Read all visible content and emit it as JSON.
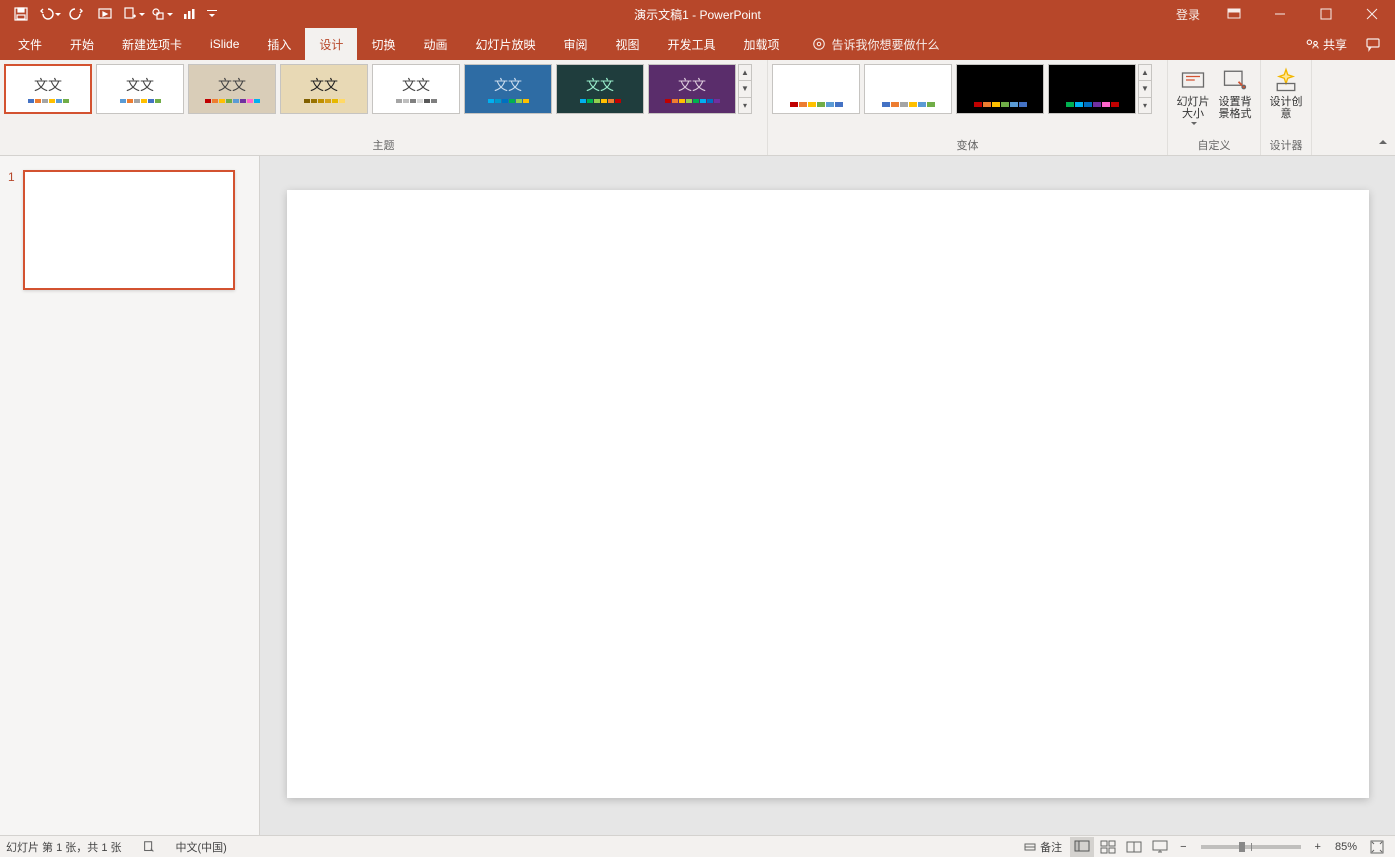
{
  "title": "演示文稿1  -  PowerPoint",
  "login": "登录",
  "tabs": [
    "文件",
    "开始",
    "新建选项卡",
    "iSlide",
    "插入",
    "设计",
    "切换",
    "动画",
    "幻灯片放映",
    "审阅",
    "视图",
    "开发工具",
    "加载项"
  ],
  "active_tab": "设计",
  "tell_me": "告诉我你想要做什么",
  "share": "共享",
  "groups": {
    "themes": "主题",
    "variants": "变体",
    "customize": "自定义",
    "designer": "设计器"
  },
  "customize": {
    "slide_size": "幻灯片大小",
    "background": "设置背景格式",
    "design_ideas": "设计创意"
  },
  "theme_sample": "文文",
  "theme_palettes": [
    [
      "#4472c4",
      "#ed7d31",
      "#a5a5a5",
      "#ffc000",
      "#5b9bd5",
      "#70ad47"
    ],
    [
      "#5b9bd5",
      "#ed7d31",
      "#a5a5a5",
      "#ffc000",
      "#4472c4",
      "#70ad47"
    ],
    [
      "#c00000",
      "#ed7d31",
      "#ffc000",
      "#70ad47",
      "#5b9bd5",
      "#7030a0",
      "#ff66cc",
      "#00b0f0"
    ],
    [
      "#806000",
      "#997300",
      "#bf8f00",
      "#d4a017",
      "#e6b800",
      "#ffd966"
    ],
    [
      "#a5a5a5",
      "#bfbfbf",
      "#808080",
      "#d9d9d9",
      "#595959",
      "#7f7f7f"
    ],
    [
      "#00b0f0",
      "#0099cc",
      "#0070c0",
      "#00b050",
      "#92d050",
      "#ffc000"
    ],
    [
      "#00b0f0",
      "#00b050",
      "#92d050",
      "#ffc000",
      "#ed7d31",
      "#c00000"
    ],
    [
      "#c00000",
      "#ed7d31",
      "#ffc000",
      "#92d050",
      "#00b050",
      "#00b0f0",
      "#0070c0",
      "#7030a0"
    ]
  ],
  "theme_backgrounds": [
    "#ffffff",
    "#ffffff",
    "#d9cdb8",
    "#e8d9b5",
    "#ffffff",
    "#2e6ca4",
    "#1f3d3d",
    "#5a2d6b"
  ],
  "theme_text_colors": [
    "#444",
    "#444",
    "#444",
    "#222",
    "#444",
    "#cde",
    "#9ec",
    "#dcd"
  ],
  "variant_backgrounds": [
    "#ffffff",
    "#ffffff",
    "#000000",
    "#000000"
  ],
  "variant_palettes": [
    [
      "#c00000",
      "#ed7d31",
      "#ffc000",
      "#70ad47",
      "#5b9bd5",
      "#4472c4"
    ],
    [
      "#4472c4",
      "#ed7d31",
      "#a5a5a5",
      "#ffc000",
      "#5b9bd5",
      "#70ad47"
    ],
    [
      "#c00000",
      "#ed7d31",
      "#ffc000",
      "#70ad47",
      "#5b9bd5",
      "#4472c4"
    ],
    [
      "#00b050",
      "#00b0f0",
      "#0070c0",
      "#7030a0",
      "#ff66cc",
      "#c00000"
    ]
  ],
  "slides": {
    "current": "1"
  },
  "status": {
    "slide_info": "幻灯片 第 1 张，共 1 张",
    "language": "中文(中国)",
    "notes": "备注",
    "zoom": "85%"
  }
}
